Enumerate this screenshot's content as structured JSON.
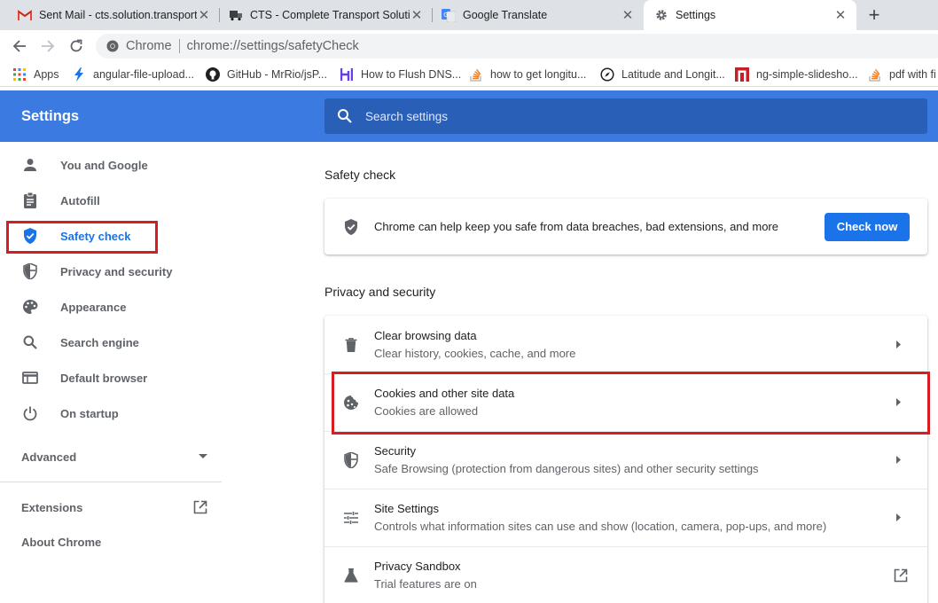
{
  "tabs": [
    {
      "title": "Sent Mail - cts.solution.transport@",
      "active": false
    },
    {
      "title": "CTS - Complete Transport Solution",
      "active": false
    },
    {
      "title": "Google Translate",
      "active": false
    },
    {
      "title": "Settings",
      "active": true
    }
  ],
  "toolbar": {
    "omnibox_label": "Chrome",
    "url": "chrome://settings/safetyCheck"
  },
  "bookmarks": [
    {
      "label": "Apps",
      "icon": "apps-grid-icon"
    },
    {
      "label": "angular-file-upload...",
      "icon": "lightning-icon"
    },
    {
      "label": "GitHub - MrRio/jsP...",
      "icon": "github-icon"
    },
    {
      "label": "How to Flush DNS...",
      "icon": "h-logo-icon"
    },
    {
      "label": "how to get longitu...",
      "icon": "stackoverflow-icon"
    },
    {
      "label": "Latitude and Longit...",
      "icon": "compass-icon"
    },
    {
      "label": "ng-simple-slidesho...",
      "icon": "red-square-icon"
    },
    {
      "label": "pdf with fi",
      "icon": "stackoverflow-icon"
    }
  ],
  "settings_header": {
    "title": "Settings",
    "search_placeholder": "Search settings"
  },
  "sidebar": {
    "items": [
      {
        "label": "You and Google",
        "icon": "person-icon"
      },
      {
        "label": "Autofill",
        "icon": "clipboard-icon"
      },
      {
        "label": "Safety check",
        "icon": "shield-check-icon",
        "selected": true
      },
      {
        "label": "Privacy and security",
        "icon": "shield-half-icon"
      },
      {
        "label": "Appearance",
        "icon": "palette-icon"
      },
      {
        "label": "Search engine",
        "icon": "search-icon"
      },
      {
        "label": "Default browser",
        "icon": "browser-window-icon"
      },
      {
        "label": "On startup",
        "icon": "power-icon"
      }
    ],
    "advanced_label": "Advanced",
    "extensions_label": "Extensions",
    "about_label": "About Chrome"
  },
  "safety_check": {
    "title": "Safety check",
    "text": "Chrome can help keep you safe from data breaches, bad extensions, and more",
    "button": "Check now"
  },
  "privacy": {
    "title": "Privacy and security",
    "rows": [
      {
        "title": "Clear browsing data",
        "subtitle": "Clear history, cookies, cache, and more",
        "icon": "trash-icon"
      },
      {
        "title": "Cookies and other site data",
        "subtitle": "Cookies are allowed",
        "icon": "cookie-icon"
      },
      {
        "title": "Security",
        "subtitle": "Safe Browsing (protection from dangerous sites) and other security settings",
        "icon": "shield-half-icon"
      },
      {
        "title": "Site Settings",
        "subtitle": "Controls what information sites can use and show (location, camera, pop-ups, and more)",
        "icon": "sliders-icon"
      },
      {
        "title": "Privacy Sandbox",
        "subtitle": "Trial features are on",
        "icon": "flask-icon"
      }
    ]
  },
  "colors": {
    "header_blue": "#3b7ae0",
    "search_blue": "#2a5fb8",
    "accent": "#1a73e8",
    "highlight_red": "#d81d22"
  }
}
